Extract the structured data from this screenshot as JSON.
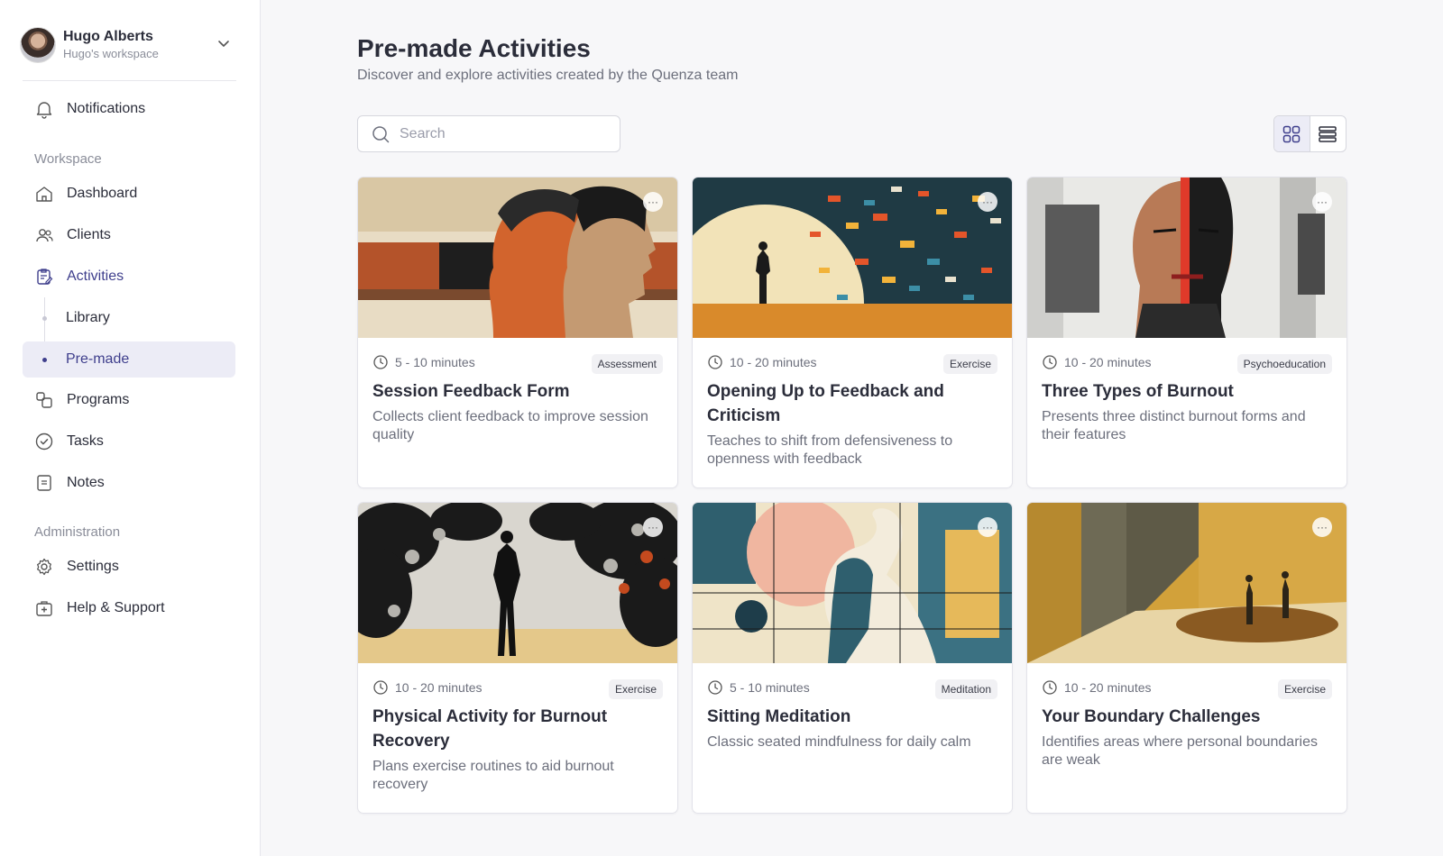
{
  "user": {
    "name": "Hugo Alberts",
    "workspace": "Hugo's workspace"
  },
  "nav": {
    "notifications": "Notifications",
    "workspace_label": "Workspace",
    "dashboard": "Dashboard",
    "clients": "Clients",
    "activities": "Activities",
    "library": "Library",
    "premade": "Pre-made",
    "programs": "Programs",
    "tasks": "Tasks",
    "notes": "Notes",
    "admin_label": "Administration",
    "settings": "Settings",
    "help": "Help & Support"
  },
  "page": {
    "title": "Pre-made Activities",
    "subtitle": "Discover and explore activities created by the Quenza team"
  },
  "search": {
    "placeholder": "Search",
    "value": ""
  },
  "view": {
    "active": "grid"
  },
  "cards": [
    {
      "duration": "5 - 10 minutes",
      "category": "Assessment",
      "title": "Session Feedback Form",
      "description": "Collects client feedback to improve session quality",
      "more": "···"
    },
    {
      "duration": "10 - 20 minutes",
      "category": "Exercise",
      "title": "Opening Up to Feedback and Criticism",
      "description": "Teaches to shift from defensiveness to openness with feedback",
      "more": "···"
    },
    {
      "duration": "10 - 20 minutes",
      "category": "Psychoeducation",
      "title": "Three Types of Burnout",
      "description": "Presents three distinct burnout forms and their features",
      "more": "···"
    },
    {
      "duration": "10 - 20 minutes",
      "category": "Exercise",
      "title": "Physical Activity for Burnout Recovery",
      "description": "Plans exercise routines to aid burnout recovery",
      "more": "···"
    },
    {
      "duration": "5 - 10 minutes",
      "category": "Meditation",
      "title": "Sitting Meditation",
      "description": "Classic seated mindfulness for daily calm",
      "more": "···"
    },
    {
      "duration": "10 - 20 minutes",
      "category": "Exercise",
      "title": "Your Boundary Challenges",
      "description": "Identifies areas where personal boundaries are weak",
      "more": "···"
    }
  ],
  "colors": {
    "accent": "#3e3e8c",
    "selected_bg": "#ececf6",
    "page_bg": "#f7f7f9"
  }
}
